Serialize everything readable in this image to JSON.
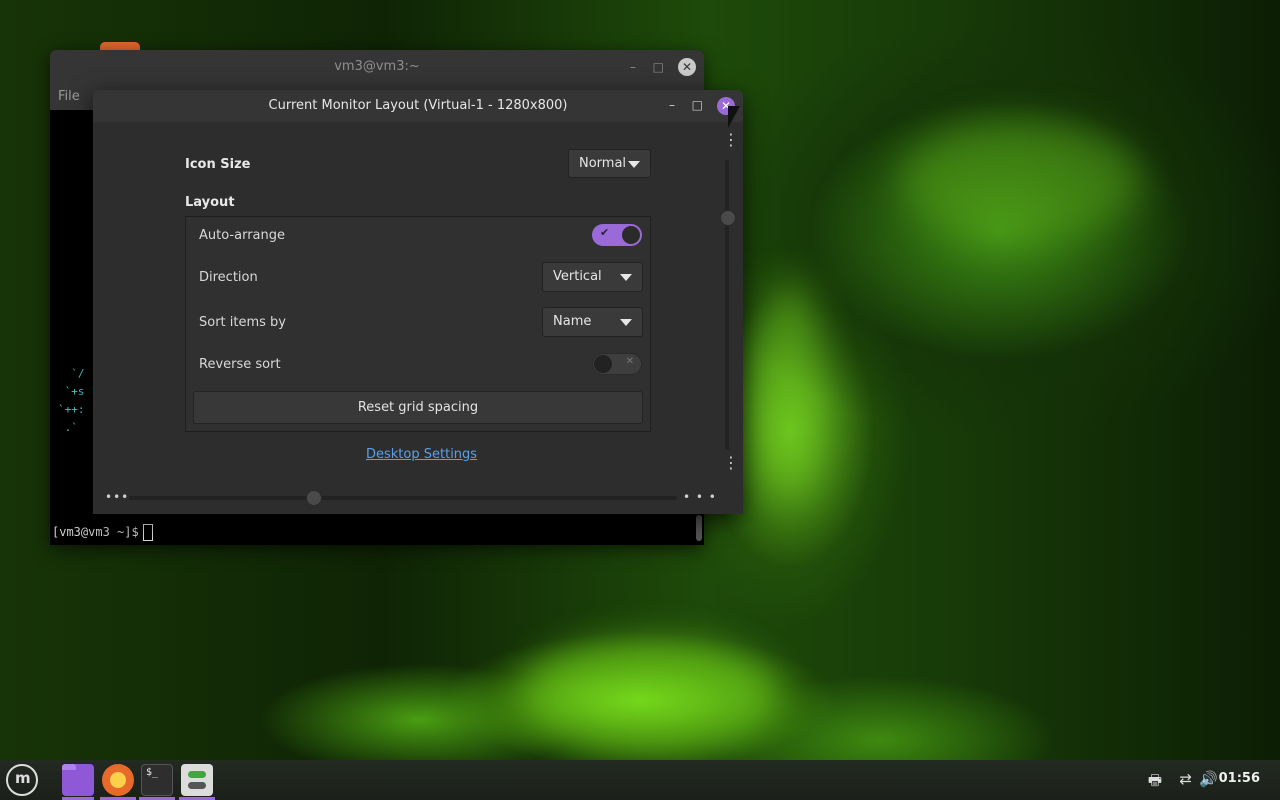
{
  "terminal": {
    "title": "vm3@vm3:~",
    "menu_file": "File",
    "ascii_lines": [
      "  `/",
      " `+s",
      "`++:",
      " .`"
    ],
    "prompt": "[vm3@vm3 ~]$",
    "min_glyph": "–",
    "max_glyph": "□",
    "close_glyph": "✕"
  },
  "dialog": {
    "title": "Current Monitor Layout (Virtual-1 - 1280x800)",
    "min_glyph": "–",
    "max_glyph": "□",
    "close_glyph": "✕",
    "icon_size_label": "Icon Size",
    "icon_size_value": "Normal",
    "layout_heading": "Layout",
    "auto_arrange_label": "Auto-arrange",
    "auto_arrange_on": true,
    "direction_label": "Direction",
    "direction_value": "Vertical",
    "sort_label": "Sort items by",
    "sort_value": "Name",
    "reverse_label": "Reverse sort",
    "reverse_on": false,
    "reset_label": "Reset grid spacing",
    "link_label": "Desktop Settings",
    "dots_h": "•••",
    "dots_h_right": "• • •",
    "dots_v": "⋮"
  },
  "taskbar": {
    "clock": "01:56",
    "apps": [
      "menu",
      "files",
      "firefox",
      "terminal",
      "settings"
    ]
  },
  "colors": {
    "accent": "#9a6bd8",
    "link": "#5aa0e6"
  }
}
